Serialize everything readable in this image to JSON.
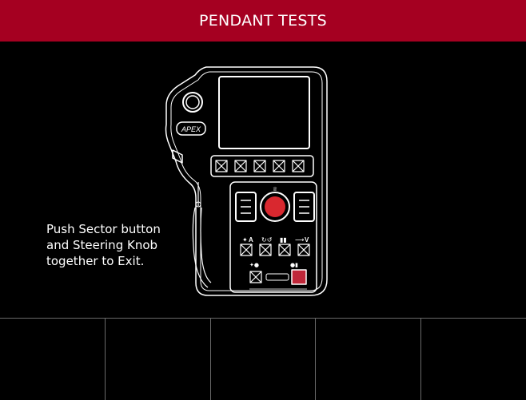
{
  "header": {
    "title": "PENDANT TESTS"
  },
  "instruction": {
    "lines": [
      "Push Sector button",
      "and Steering Knob",
      "together to Exit."
    ]
  },
  "pendant": {
    "brand": "APEX",
    "row_labels": [
      "A",
      "V"
    ],
    "status_colors": {
      "steering_knob": "#d9282f",
      "sector_button": "#c0283a"
    }
  },
  "softkeys": [
    {
      "label": ""
    },
    {
      "label": ""
    },
    {
      "label": ""
    },
    {
      "label": ""
    },
    {
      "label": ""
    }
  ],
  "colors": {
    "header_bg": "#a50021",
    "background": "#000000",
    "outline": "#ffffff"
  }
}
